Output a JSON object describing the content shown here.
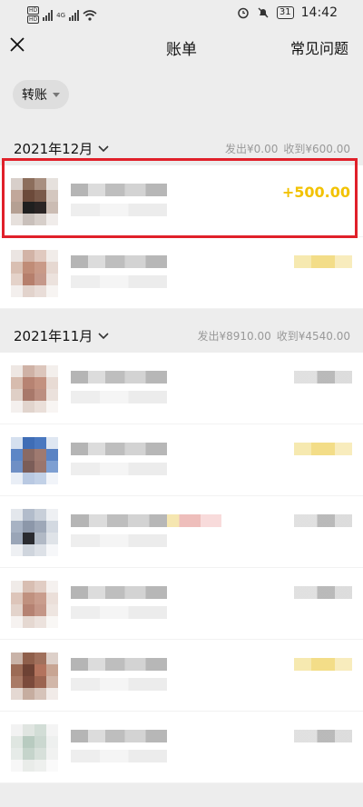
{
  "status_bar": {
    "network_left": "HD",
    "net_4g": "4G",
    "battery": "31",
    "time": "14:42"
  },
  "header": {
    "title": "账单",
    "faq_label": "常见问题"
  },
  "filter": {
    "label": "转账"
  },
  "sections": [
    {
      "month": "2021年12月",
      "sent": "发出¥0.00",
      "received": "收到¥600.00",
      "rows": [
        {
          "amount": "+500.00",
          "highlight": true
        },
        {
          "amount": ""
        }
      ]
    },
    {
      "month": "2021年11月",
      "sent": "发出¥8910.00",
      "received": "收到¥4540.00",
      "rows": [
        {},
        {},
        {},
        {},
        {},
        {}
      ]
    }
  ],
  "colors": {
    "accent_amount": "#f2c200",
    "highlight_border": "#e0202a"
  }
}
